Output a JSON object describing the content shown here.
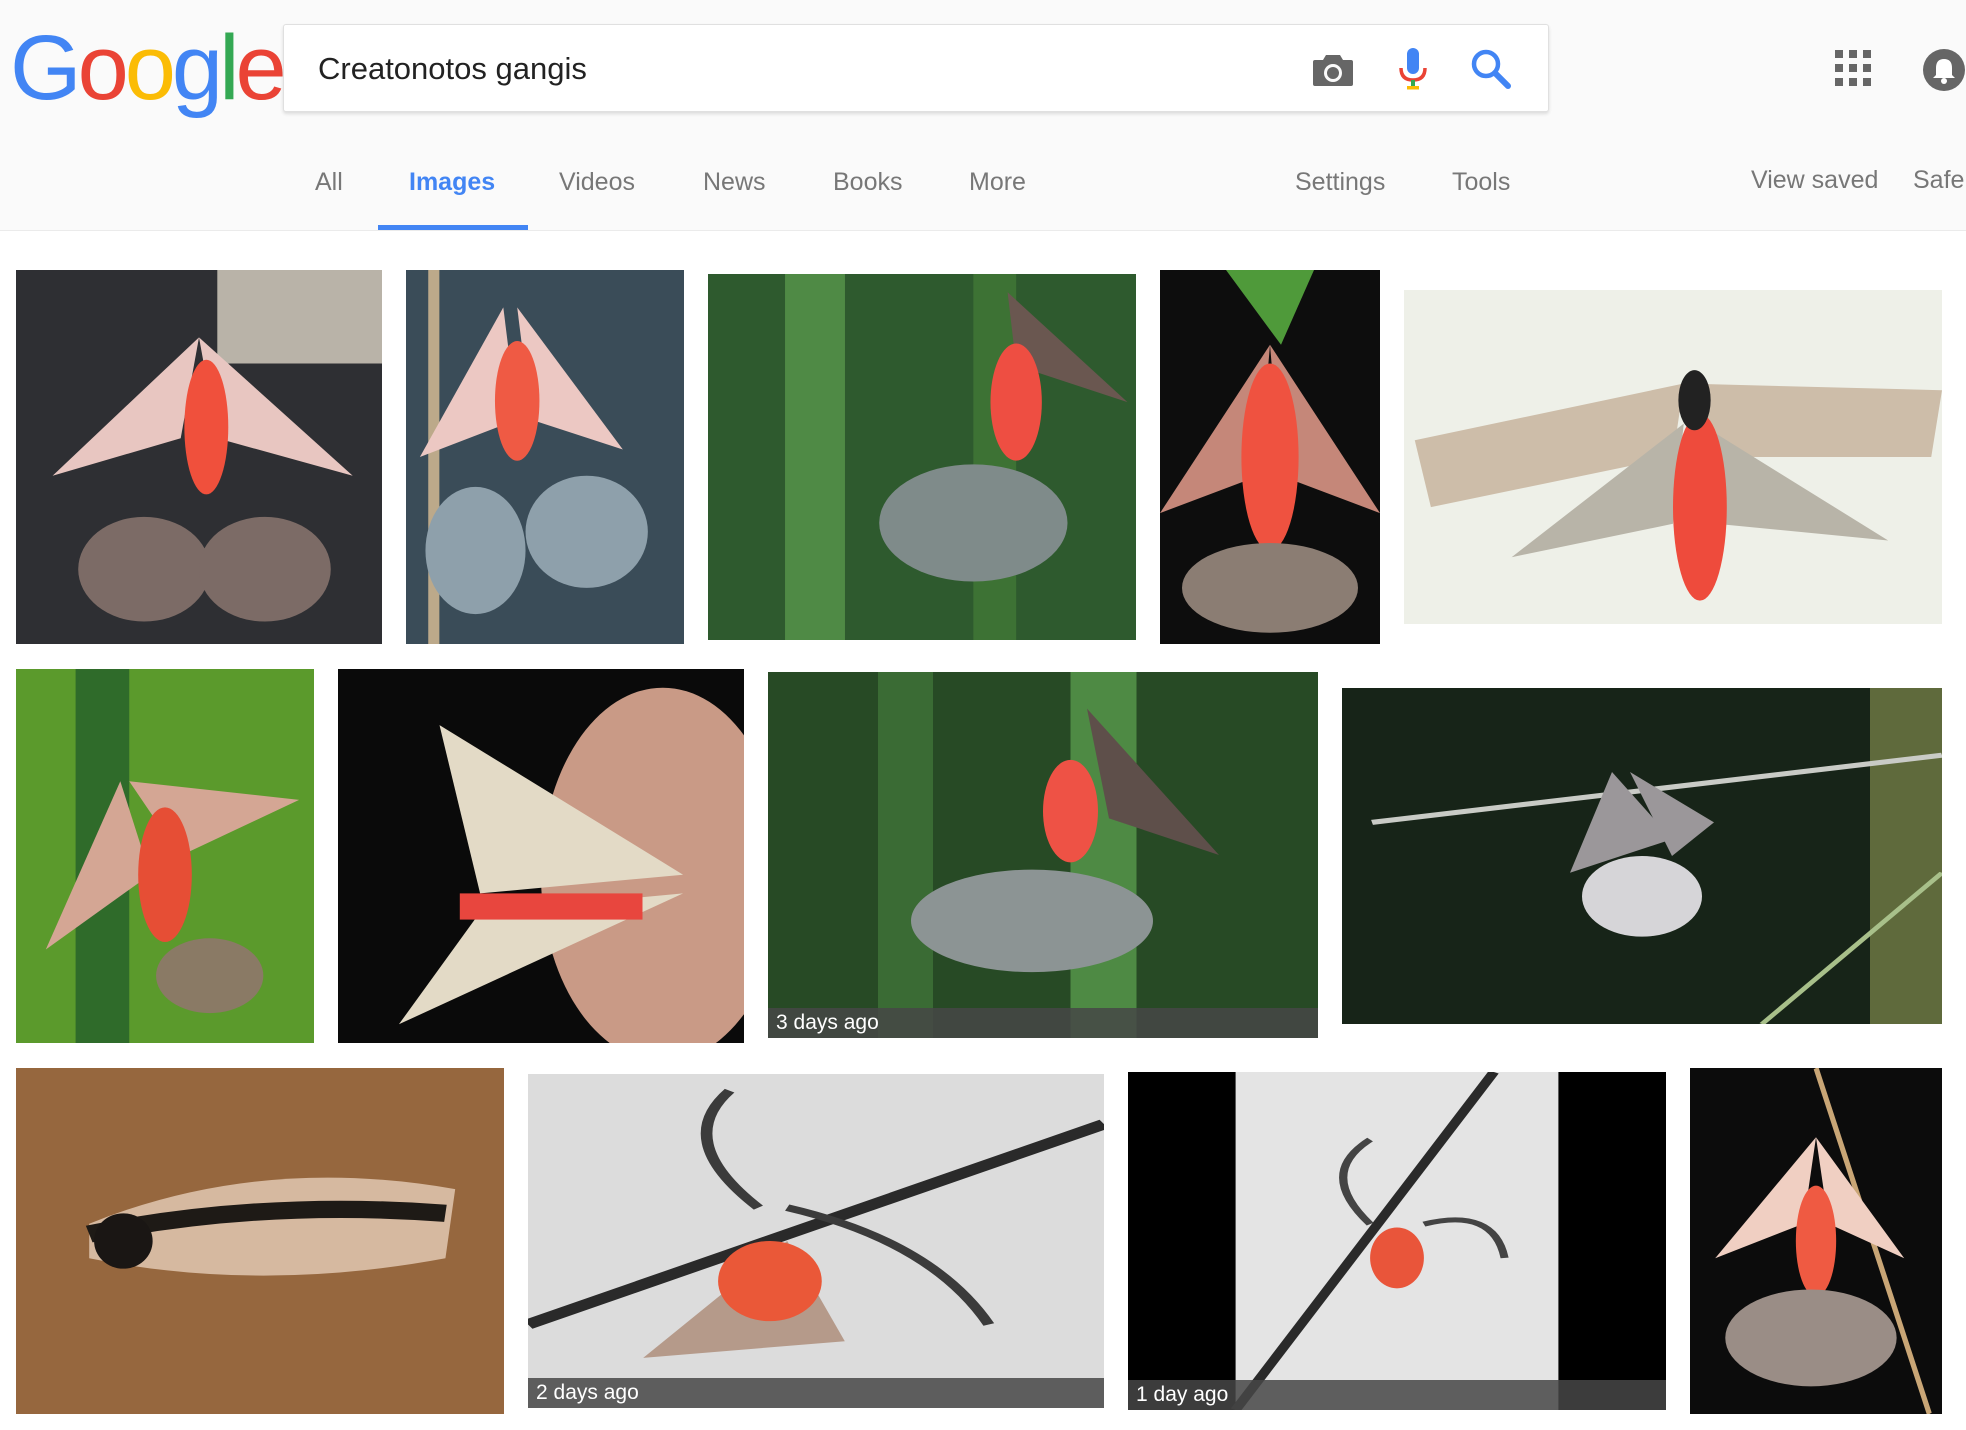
{
  "logo": {
    "text": "Google",
    "letters": [
      "G",
      "o",
      "o",
      "g",
      "l",
      "e"
    ],
    "colors": [
      "#4285f4",
      "#ea4335",
      "#fbbc05",
      "#4285f4",
      "#34a853",
      "#ea4335"
    ]
  },
  "search": {
    "query": "Creatonotos gangis",
    "icons": [
      "camera-icon",
      "microphone-icon",
      "search-icon"
    ]
  },
  "header_icons": [
    "apps-grid-icon",
    "notifications-icon"
  ],
  "tabs": [
    {
      "label": "All"
    },
    {
      "label": "Images",
      "active": true
    },
    {
      "label": "Videos"
    },
    {
      "label": "News"
    },
    {
      "label": "Books"
    },
    {
      "label": "More"
    }
  ],
  "tools": [
    {
      "label": "Settings"
    },
    {
      "label": "Tools"
    }
  ],
  "right_links": [
    {
      "label": "View saved"
    },
    {
      "label": "Safe"
    }
  ],
  "accent_color": "#4285f4",
  "results": [
    {
      "subject": "moth with red abdomen and extended hairy coremata on dark background"
    },
    {
      "subject": "moth hanging on plant stem with grey hairy coremata"
    },
    {
      "subject": "moth with coremata against green blurred background"
    },
    {
      "subject": "moth under green leaf on black background"
    },
    {
      "subject": "moth with spread wings on white background"
    },
    {
      "subject": "moth on green stem against green background"
    },
    {
      "subject": "moth resting on human finger"
    },
    {
      "subject": "moth with coremata on green background",
      "badge": "3 days ago"
    },
    {
      "subject": "pale moth on grass with white coremata"
    },
    {
      "subject": "moth with folded striped wings on wood"
    },
    {
      "subject": "moth with coremata on white surface",
      "badge": "2 days ago"
    },
    {
      "subject": "moth on diagonal stick, white background",
      "badge": "1 day ago"
    },
    {
      "subject": "moth hanging on dry plant with coremata"
    }
  ]
}
